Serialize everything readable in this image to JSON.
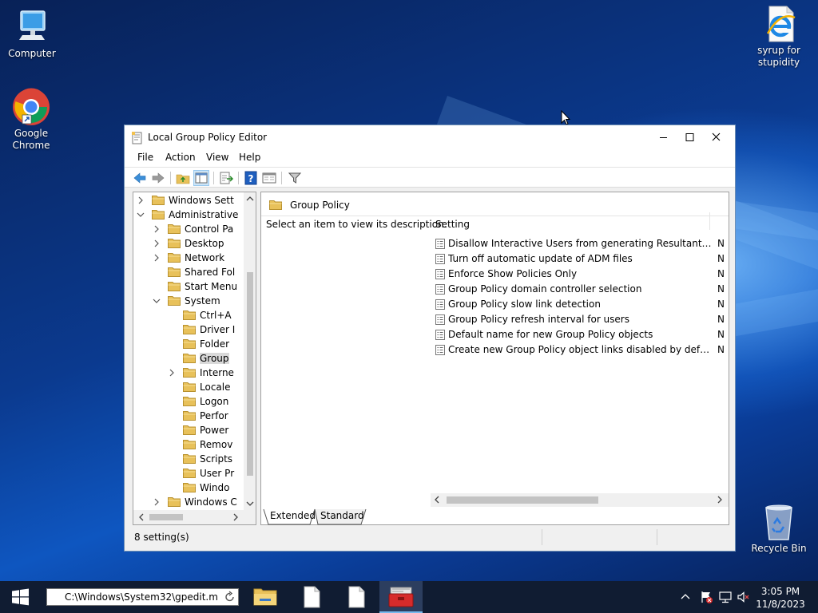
{
  "desktop": {
    "icons": [
      {
        "label": "Computer"
      },
      {
        "label": "Google\nChrome"
      },
      {
        "label": "syrup for\nstupidity"
      },
      {
        "label": "Recycle Bin"
      }
    ]
  },
  "window": {
    "title": "Local Group Policy Editor",
    "menu": [
      "File",
      "Action",
      "View",
      "Help"
    ]
  },
  "tree": {
    "items": [
      {
        "label": "Windows Sett",
        "level": 1,
        "expander": "collapsed"
      },
      {
        "label": "Administrative",
        "level": 1,
        "expander": "expanded"
      },
      {
        "label": "Control Pa",
        "level": 2,
        "expander": "collapsed"
      },
      {
        "label": "Desktop",
        "level": 2,
        "expander": "collapsed"
      },
      {
        "label": "Network",
        "level": 2,
        "expander": "collapsed"
      },
      {
        "label": "Shared Fol",
        "level": 2,
        "expander": "none"
      },
      {
        "label": "Start Menu",
        "level": 2,
        "expander": "none"
      },
      {
        "label": "System",
        "level": 2,
        "expander": "expanded"
      },
      {
        "label": "Ctrl+A",
        "level": 3,
        "expander": "none"
      },
      {
        "label": "Driver I",
        "level": 3,
        "expander": "none"
      },
      {
        "label": "Folder",
        "level": 3,
        "expander": "none"
      },
      {
        "label": "Group",
        "level": 3,
        "expander": "none",
        "selected": true
      },
      {
        "label": "Interne",
        "level": 3,
        "expander": "collapsed"
      },
      {
        "label": "Locale",
        "level": 3,
        "expander": "none"
      },
      {
        "label": "Logon",
        "level": 3,
        "expander": "none"
      },
      {
        "label": "Perfor",
        "level": 3,
        "expander": "none"
      },
      {
        "label": "Power",
        "level": 3,
        "expander": "none"
      },
      {
        "label": "Remov",
        "level": 3,
        "expander": "none"
      },
      {
        "label": "Scripts",
        "level": 3,
        "expander": "none"
      },
      {
        "label": "User Pr",
        "level": 3,
        "expander": "none"
      },
      {
        "label": "Windo",
        "level": 3,
        "expander": "none"
      },
      {
        "label": "Windows C",
        "level": 2,
        "expander": "collapsed"
      }
    ]
  },
  "details": {
    "header": "Group Policy",
    "description": "Select an item to view its description.",
    "column_setting": "Setting",
    "settings": [
      {
        "name": "Disallow Interactive Users from generating Resultant Set of P...",
        "state": "N"
      },
      {
        "name": "Turn off automatic update of ADM files",
        "state": "N"
      },
      {
        "name": "Enforce Show Policies Only",
        "state": "N"
      },
      {
        "name": "Group Policy domain controller selection",
        "state": "N"
      },
      {
        "name": "Group Policy slow link detection",
        "state": "N"
      },
      {
        "name": "Group Policy refresh interval for users",
        "state": "N"
      },
      {
        "name": "Default name for new Group Policy objects",
        "state": "N"
      },
      {
        "name": "Create new Group Policy object links disabled by default",
        "state": "N"
      }
    ],
    "tabs": [
      "Extended",
      "Standard"
    ]
  },
  "status": {
    "text": "8 setting(s)"
  },
  "taskbar": {
    "run_value": "C:\\Windows\\System32\\gpedit.m",
    "clock_time": "3:05 PM",
    "clock_date": "11/8/2023"
  },
  "colors": {
    "accent": "#76b9ed",
    "taskbar": "#101c32",
    "folder": "#e8c15a"
  }
}
